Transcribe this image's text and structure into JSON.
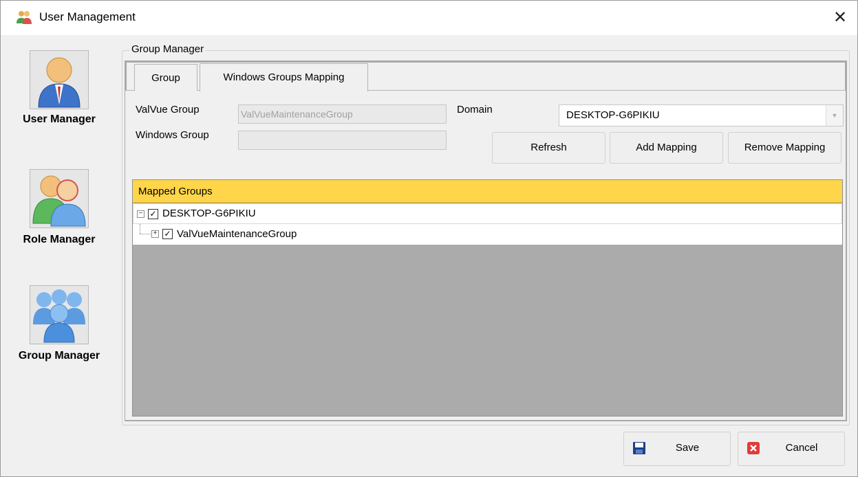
{
  "window": {
    "title": "User Management",
    "close_glyph": "✕"
  },
  "sidebar": {
    "items": [
      {
        "label": "User Manager",
        "icon": "user-manager-icon"
      },
      {
        "label": "Role Manager",
        "icon": "role-manager-icon"
      },
      {
        "label": "Group Manager",
        "icon": "group-manager-icon"
      }
    ]
  },
  "group_box": {
    "legend": "Group Manager"
  },
  "tabs": [
    {
      "label": "Group",
      "active": false
    },
    {
      "label": "Windows Groups Mapping",
      "active": true
    }
  ],
  "form": {
    "valvue_group_label": "ValVue Group",
    "valvue_group_value": "ValVueMaintenanceGroup",
    "windows_group_label": "Windows Group",
    "windows_group_value": "",
    "domain_label": "Domain",
    "domain_value": "DESKTOP-G6PIKIU",
    "refresh_label": "Refresh",
    "add_mapping_label": "Add Mapping",
    "remove_mapping_label": "Remove Mapping"
  },
  "tree": {
    "header": "Mapped Groups",
    "nodes": [
      {
        "label": "DESKTOP-G6PIKIU",
        "checked": true,
        "expander": "⊟"
      },
      {
        "label": "ValVueMaintenanceGroup",
        "checked": true,
        "expander": "⊞"
      }
    ]
  },
  "footer": {
    "save_label": "Save",
    "cancel_label": "Cancel"
  },
  "colors": {
    "tree_header": "#ffd54a",
    "tree_empty_area": "#ababab",
    "cancel_icon": "#e03b3b",
    "save_icon": "#1f3f87"
  }
}
